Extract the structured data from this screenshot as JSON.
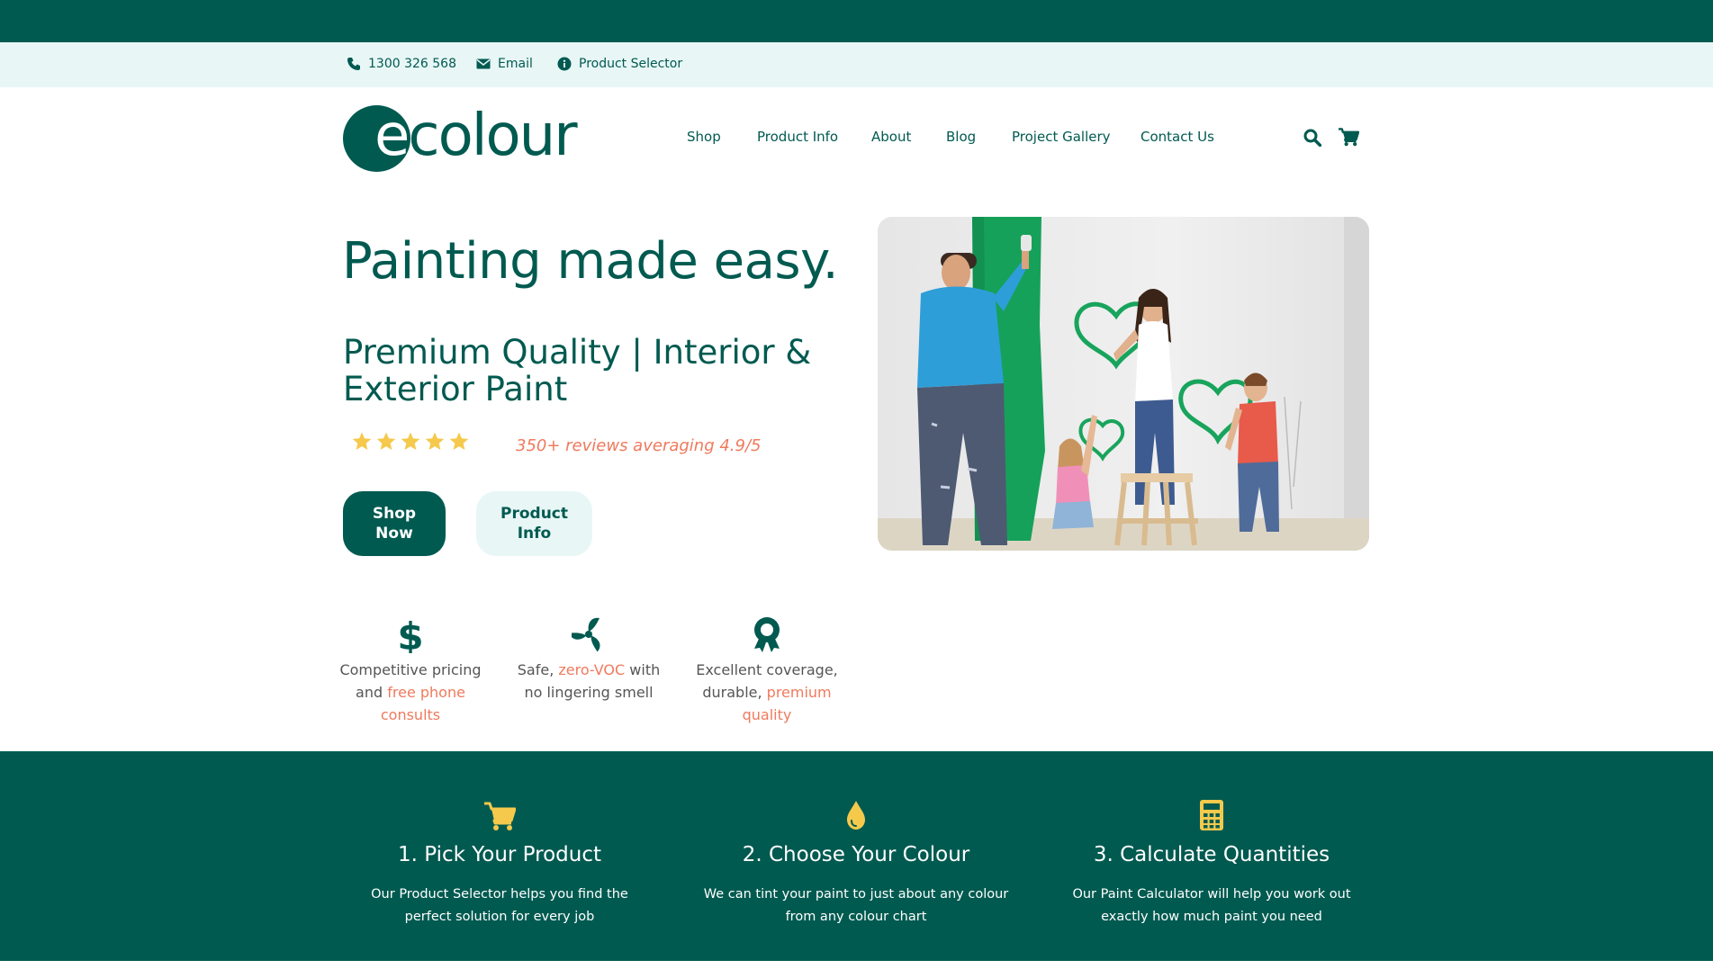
{
  "utility_bar": {
    "phone": "1300 326 568",
    "email": "Email",
    "product_selector": "Product Selector"
  },
  "logo": {
    "text_e": "e",
    "text_rest": "colour"
  },
  "nav": {
    "items": [
      "Shop",
      "Product Info",
      "About",
      "Blog",
      "Project Gallery",
      "Contact Us"
    ]
  },
  "hero": {
    "title": "Painting made easy.",
    "subtitle": "Premium Quality | Interior & Exterior Paint",
    "rating": 5,
    "reviews": "350+ reviews averaging 4.9/5",
    "btn_shop": "Shop\nNow",
    "btn_info": "Product\nInfo"
  },
  "features": [
    {
      "pre": "Competitive pricing and ",
      "hl": "free phone consults",
      "post": "",
      "icon": "dollar-icon"
    },
    {
      "pre": "Safe, ",
      "hl": "zero-VOC",
      "post": " with no lingering smell",
      "icon": "fan-icon"
    },
    {
      "pre": "Excellent coverage, durable, ",
      "hl": "premium quality",
      "post": "",
      "icon": "award-icon"
    }
  ],
  "steps": [
    {
      "title": "1. Pick Your Product",
      "desc": "Our Product Selector helps you find the perfect solution for every job",
      "icon": "cart-icon"
    },
    {
      "title": "2. Choose Your Colour",
      "desc": "We can tint your paint to just about any colour from any colour chart",
      "icon": "drop-icon"
    },
    {
      "title": "3. Calculate Quantities",
      "desc": "Our Paint Calculator will help you work out exactly how much paint you need",
      "icon": "calculator-icon"
    }
  ],
  "colors": {
    "brand": "#005a50",
    "accent": "#ef7a5d",
    "star": "#f5c94c",
    "light": "#e8f6f6"
  }
}
